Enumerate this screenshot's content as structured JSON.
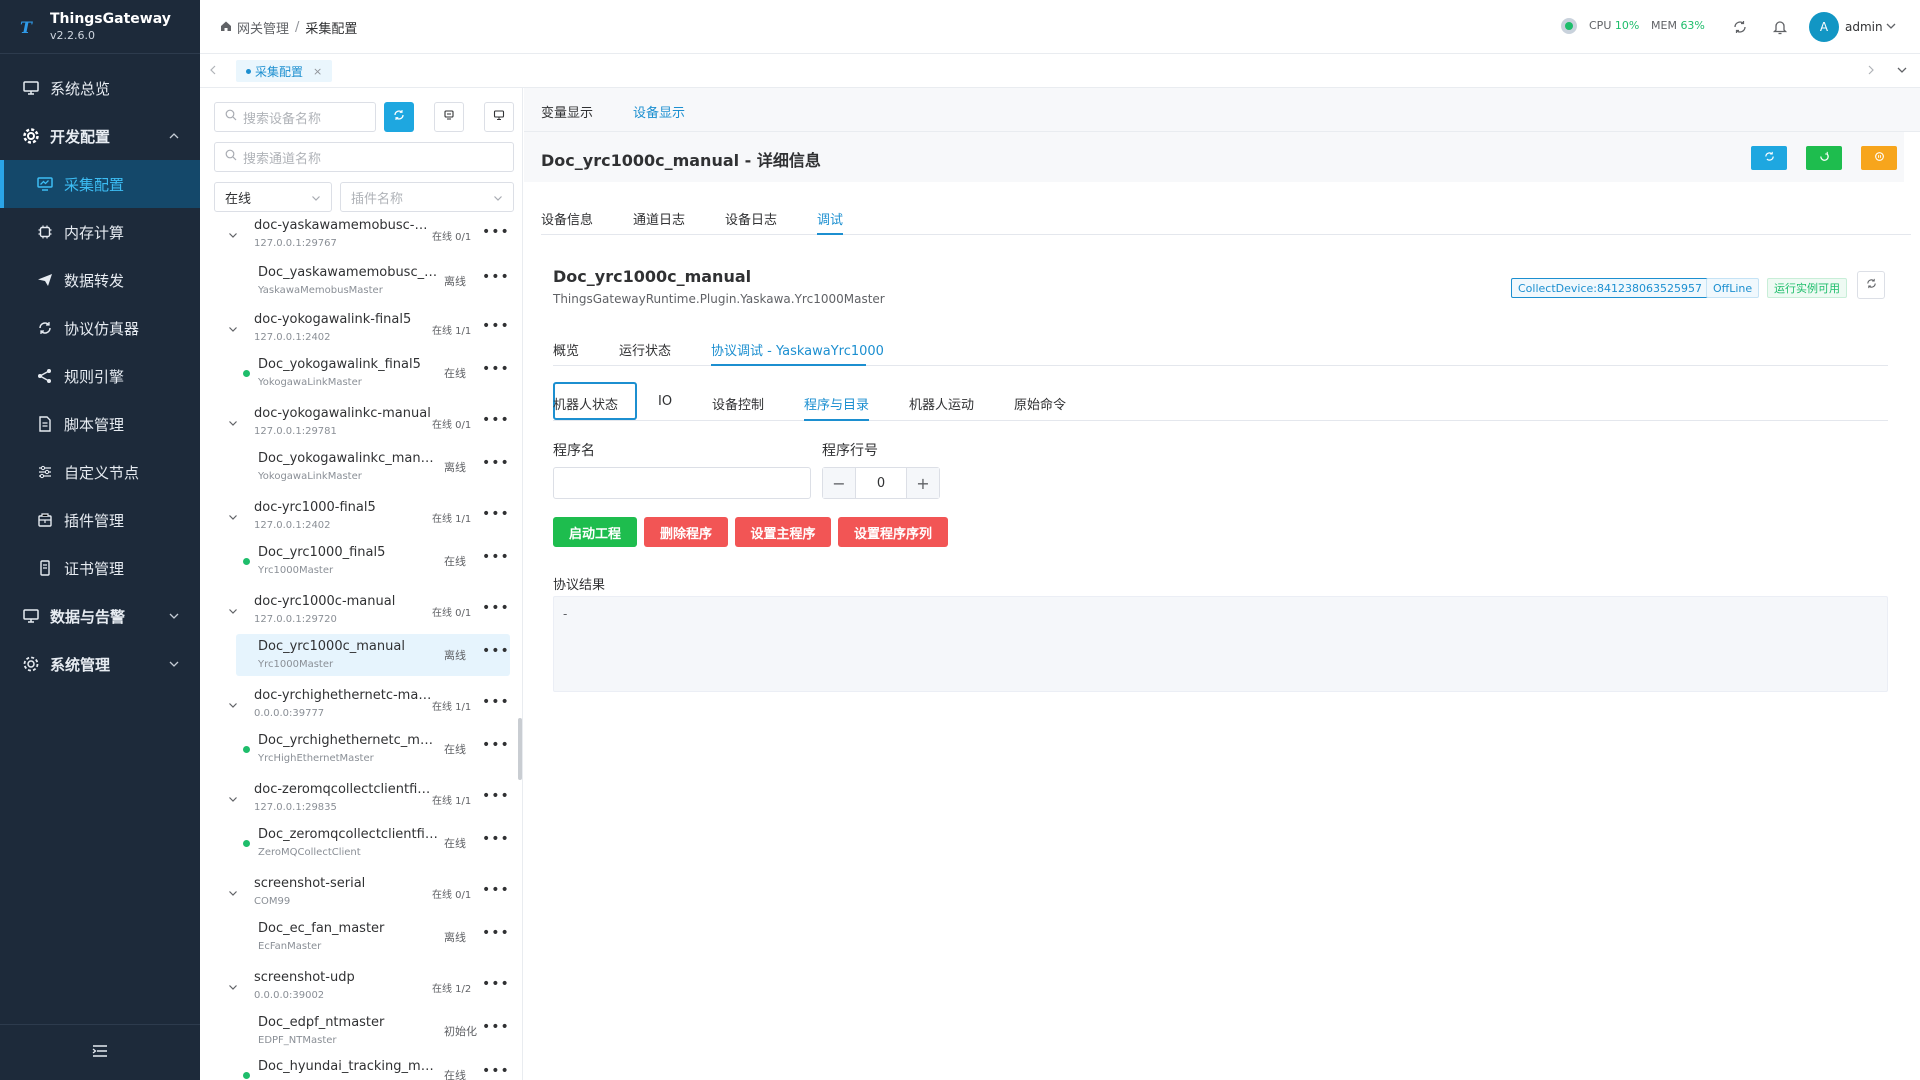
{
  "app": {
    "name": "ThingsGateway",
    "version": "v2.2.6.0"
  },
  "sidebar": {
    "items": [
      {
        "label": "系统总览",
        "icon": "monitor-icon"
      },
      {
        "label": "开发配置",
        "icon": "gear-icon"
      },
      {
        "label": "采集配置",
        "icon": "chart-monitor-icon"
      },
      {
        "label": "内存计算",
        "icon": "chip-icon"
      },
      {
        "label": "数据转发",
        "icon": "send-icon"
      },
      {
        "label": "协议仿真器",
        "icon": "sync-icon"
      },
      {
        "label": "规则引擎",
        "icon": "share-icon"
      },
      {
        "label": "脚本管理",
        "icon": "document-icon"
      },
      {
        "label": "自定义节点",
        "icon": "sliders-icon"
      },
      {
        "label": "插件管理",
        "icon": "package-icon"
      },
      {
        "label": "证书管理",
        "icon": "certificate-icon"
      },
      {
        "label": "数据与告警",
        "icon": "monitor-icon"
      },
      {
        "label": "系统管理",
        "icon": "gear-icon"
      }
    ]
  },
  "header": {
    "breadcrumb": [
      "网关管理",
      "/",
      "采集配置"
    ],
    "cpu_label": "CPU",
    "cpu_value": "10%",
    "mem_label": "MEM",
    "mem_value": "63%",
    "avatar_letter": "A",
    "username": "admin"
  },
  "tabs": {
    "active": "采集配置",
    "close": "×"
  },
  "list": {
    "search_device_placeholder": "搜索设备名称",
    "search_channel_placeholder": "搜索通道名称",
    "status_filter": "在线",
    "plugin_filter_placeholder": "插件名称",
    "channels": [
      {
        "name": "doc-yaskawamemobusc-m...",
        "addr": "127.0.0.1:29767",
        "status": "在线 0/1",
        "more": "•••",
        "devices": [
          {
            "name": "Doc_yaskawamemobusc_ma...",
            "plugin": "YaskawaMemobusMaster",
            "status": "离线",
            "more": "•••"
          }
        ]
      },
      {
        "name": "doc-yokogawalink-final5",
        "addr": "127.0.0.1:2402",
        "status": "在线 1/1",
        "more": "•••",
        "devices": [
          {
            "name": "Doc_yokogawalink_final5",
            "plugin": "YokogawaLinkMaster",
            "status": "在线",
            "more": "•••"
          }
        ]
      },
      {
        "name": "doc-yokogawalinkc-manual",
        "addr": "127.0.0.1:29781",
        "status": "在线 0/1",
        "more": "•••",
        "devices": [
          {
            "name": "Doc_yokogawalinkc_manual",
            "plugin": "YokogawaLinkMaster",
            "status": "离线",
            "more": "•••"
          }
        ]
      },
      {
        "name": "doc-yrc1000-final5",
        "addr": "127.0.0.1:2402",
        "status": "在线 1/1",
        "more": "•••",
        "devices": [
          {
            "name": "Doc_yrc1000_final5",
            "plugin": "Yrc1000Master",
            "status": "在线",
            "more": "•••"
          }
        ]
      },
      {
        "name": "doc-yrc1000c-manual",
        "addr": "127.0.0.1:29720",
        "status": "在线 0/1",
        "more": "•••",
        "devices": [
          {
            "name": "Doc_yrc1000c_manual",
            "plugin": "Yrc1000Master",
            "status": "离线",
            "more": "•••"
          }
        ]
      },
      {
        "name": "doc-yrchighethernetc-man...",
        "addr": "0.0.0.0:39777",
        "status": "在线 1/1",
        "more": "•••",
        "devices": [
          {
            "name": "Doc_yrchighethernetc_manual",
            "plugin": "YrcHighEthernetMaster",
            "status": "在线",
            "more": "•••"
          }
        ]
      },
      {
        "name": "doc-zeromqcollectclientfin...",
        "addr": "127.0.0.1:29835",
        "status": "在线 1/1",
        "more": "•••",
        "devices": [
          {
            "name": "Doc_zeromqcollectclientfinal...",
            "plugin": "ZeroMQCollectClient",
            "status": "在线",
            "more": "•••"
          }
        ]
      },
      {
        "name": "screenshot-serial",
        "addr": "COM99",
        "status": "在线 0/1",
        "more": "•••",
        "devices": [
          {
            "name": "Doc_ec_fan_master",
            "plugin": "EcFanMaster",
            "status": "离线",
            "more": "•••"
          }
        ]
      },
      {
        "name": "screenshot-udp",
        "addr": "0.0.0.0:39002",
        "status": "在线 1/2",
        "more": "•••",
        "devices": [
          {
            "name": "Doc_edpf_ntmaster",
            "plugin": "EDPF_NTMaster",
            "status": "初始化",
            "more": "•••"
          },
          {
            "name": "Doc_hyundai_tracking_master",
            "plugin": "",
            "status": "在线",
            "more": "•••"
          }
        ]
      }
    ]
  },
  "detail": {
    "top_tabs": [
      "变量显示",
      "设备显示"
    ],
    "title": "Doc_yrc1000c_manual - 详细信息",
    "tabs": [
      "设备信息",
      "通道日志",
      "设备日志",
      "调试"
    ],
    "device_name": "Doc_yrc1000c_manual",
    "device_plugin": "ThingsGatewayRuntime.Plugin.Yaskawa.Yrc1000Master",
    "tag_collect": "CollectDevice:841238063525957",
    "tag_offline": "OffLine",
    "tag_running": "运行实例可用",
    "sub_tabs": [
      "概览",
      "运行状态",
      "协议调试 - YaskawaYrc1000"
    ],
    "debug_tabs": [
      "机器人状态",
      "IO",
      "设备控制",
      "程序与目录",
      "机器人运动",
      "原始命令"
    ],
    "program_name_label": "程序名",
    "program_name_value": "",
    "line_label": "程序行号",
    "line_value": "0",
    "buttons": [
      "启动工程",
      "删除程序",
      "设置主程序",
      "设置程序序列"
    ],
    "result_label": "协议结果",
    "result_value": "-"
  },
  "colors": {
    "accent": "#1c8fd0",
    "sidebar_bg": "#1d2a3a",
    "green": "#1ebd6b",
    "red": "#f25555",
    "orange": "#f7a51c"
  }
}
